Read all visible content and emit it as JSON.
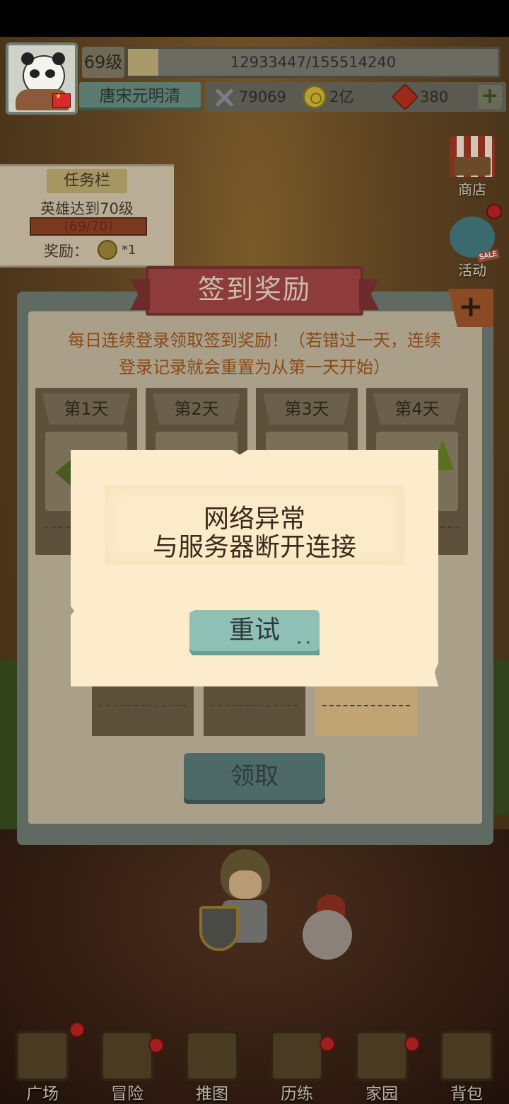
{
  "player": {
    "level": "69级",
    "exp": "12933447/155514240",
    "exp_fraction": 0.083,
    "name": "唐宋元明清",
    "power": "79069",
    "gold": "2亿",
    "gems": "380",
    "add_label": "+"
  },
  "side": {
    "shop": "商店",
    "event": "活动"
  },
  "task": {
    "title": "任务栏",
    "desc": "英雄达到70级",
    "progress": "(69/70)",
    "progress_fraction": 0.986,
    "reward_label": "奖励：",
    "reward_count": "*1"
  },
  "signin": {
    "title": "签到奖励",
    "close": "+",
    "desc_line1": "每日连续登录领取签到奖励！（若错过一天，连续",
    "desc_line2": "登录记录就会重置为从第一天开始）",
    "days": [
      "第1天",
      "第2天",
      "第3天",
      "第4天"
    ],
    "claim": "领取"
  },
  "modal": {
    "line1": "网络异常",
    "line2": "与服务器断开连接",
    "retry": "重试"
  },
  "nav": {
    "items": [
      "广场",
      "冒险",
      "推图",
      "历练",
      "家园",
      "背包"
    ]
  },
  "colors": {
    "modal_bg": "#fdeccb",
    "retry_btn": "#8ec0b5",
    "desc_text": "#8a4a18"
  }
}
